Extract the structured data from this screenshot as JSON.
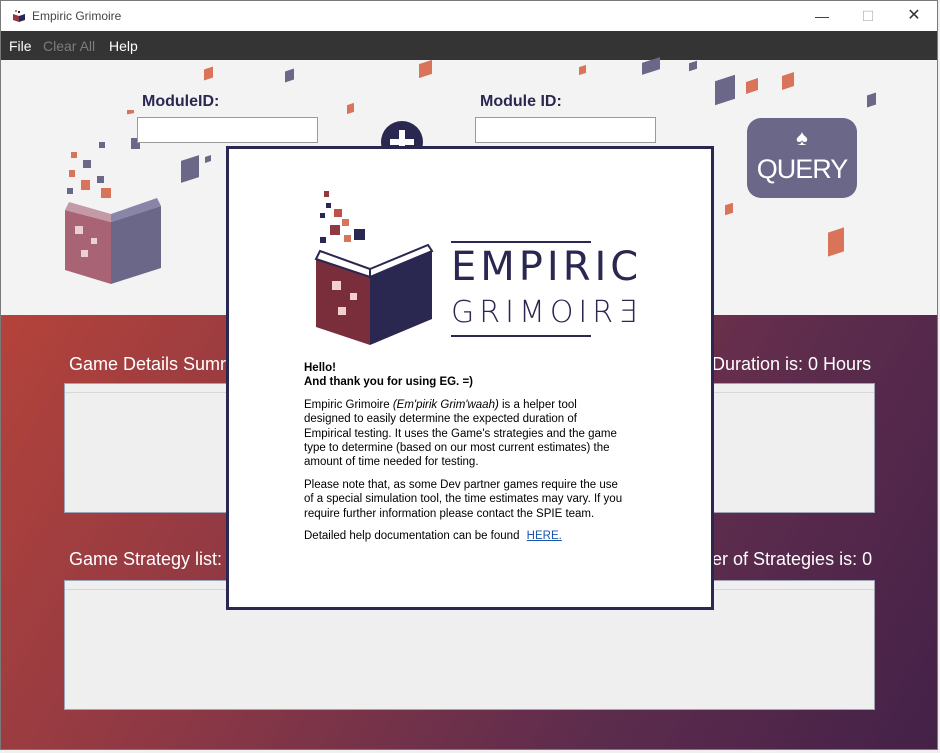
{
  "window": {
    "title": "Empiric Grimoire"
  },
  "menu": {
    "file": "File",
    "clear_all": "Clear All",
    "help": "Help"
  },
  "form": {
    "module_id_label_1": "ModuleID:",
    "module_id_label_2": "Module ID:",
    "query_label": "QUERY"
  },
  "sections": {
    "details_title_left": "Game Details Sumr",
    "duration_text": "Duration is: 0 Hours",
    "strategy_title_left": "Game Strategy list:",
    "strategies_count_text": "er of Strategies is: 0"
  },
  "about": {
    "logo_line1": "EMPIRIC",
    "logo_line2": "GRIMOIRƎ",
    "hello": "Hello!",
    "thanks": "And thank you for using EG. =)",
    "p1_before": "Empiric Grimoire ",
    "p1_italic": "(Em'pirik Grim'waah)",
    "p1_after": " is a helper tool designed to easily determine the expected duration of Empirical testing. It uses the Game's strategies and the game type to determine (based on our most current estimates) the amount of time needed for testing.",
    "p2": "Please note that, as some Dev partner games require the use of a special simulation tool, the time estimates may vary. If you require further information please contact the SPIE team.",
    "doc_text": "Detailed help documentation can be found",
    "link_text": "HERE."
  },
  "colors": {
    "navy": "#2a2750",
    "accent": "#d9735a",
    "menubar": "#343434",
    "query": "#6a6788"
  }
}
